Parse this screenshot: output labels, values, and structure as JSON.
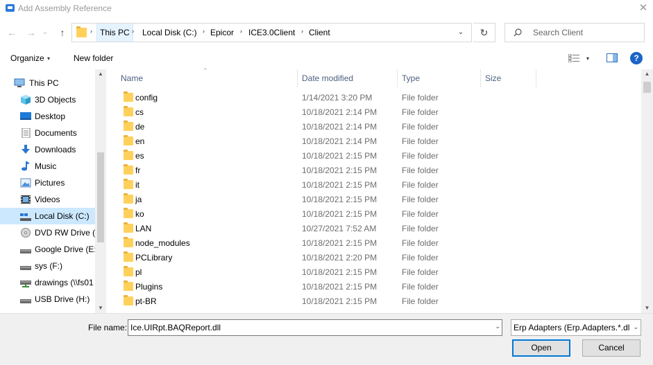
{
  "window": {
    "title": "Add Assembly Reference",
    "close_glyph": "✕"
  },
  "nav": {
    "back": "←",
    "forward": "→",
    "recent": "⌄",
    "up": "↑"
  },
  "address": {
    "crumbs": [
      "This PC",
      "Local Disk (C:)",
      "Epicor",
      "ICE3.0Client",
      "Client"
    ],
    "separator": "›",
    "dropdown_glyph": "⌄",
    "refresh_glyph": "↻"
  },
  "search": {
    "placeholder": "Search Client"
  },
  "toolbar": {
    "organize_label": "Organize",
    "caret": "▾",
    "new_folder_label": "New folder",
    "help_label": "?"
  },
  "sidebar": {
    "items": [
      {
        "label": "This PC",
        "icon": "computer-icon"
      },
      {
        "label": "3D Objects",
        "icon": "cube-icon"
      },
      {
        "label": "Desktop",
        "icon": "desktop-icon"
      },
      {
        "label": "Documents",
        "icon": "document-icon"
      },
      {
        "label": "Downloads",
        "icon": "download-icon"
      },
      {
        "label": "Music",
        "icon": "music-icon"
      },
      {
        "label": "Pictures",
        "icon": "pictures-icon"
      },
      {
        "label": "Videos",
        "icon": "video-icon"
      },
      {
        "label": "Local Disk (C:)",
        "icon": "drive-icon",
        "selected": true
      },
      {
        "label": "DVD RW Drive (D",
        "icon": "dvd-icon"
      },
      {
        "label": "Google Drive (E:)",
        "icon": "drive-icon"
      },
      {
        "label": "sys (F:)",
        "icon": "drive-icon"
      },
      {
        "label": "drawings (\\\\fs01",
        "icon": "network-drive-icon"
      },
      {
        "label": "USB Drive (H:)",
        "icon": "drive-icon"
      }
    ],
    "scroll_up": "▲",
    "scroll_down": "▼"
  },
  "columns": {
    "name": "Name",
    "date": "Date modified",
    "type": "Type",
    "size": "Size",
    "sort_glyph": "^"
  },
  "files": [
    {
      "name": "config",
      "date": "1/14/2021 3:20 PM",
      "type": "File folder"
    },
    {
      "name": "cs",
      "date": "10/18/2021 2:14 PM",
      "type": "File folder"
    },
    {
      "name": "de",
      "date": "10/18/2021 2:14 PM",
      "type": "File folder"
    },
    {
      "name": "en",
      "date": "10/18/2021 2:14 PM",
      "type": "File folder"
    },
    {
      "name": "es",
      "date": "10/18/2021 2:15 PM",
      "type": "File folder"
    },
    {
      "name": "fr",
      "date": "10/18/2021 2:15 PM",
      "type": "File folder"
    },
    {
      "name": "it",
      "date": "10/18/2021 2:15 PM",
      "type": "File folder"
    },
    {
      "name": "ja",
      "date": "10/18/2021 2:15 PM",
      "type": "File folder"
    },
    {
      "name": "ko",
      "date": "10/18/2021 2:15 PM",
      "type": "File folder"
    },
    {
      "name": "LAN",
      "date": "10/27/2021 7:52 AM",
      "type": "File folder"
    },
    {
      "name": "node_modules",
      "date": "10/18/2021 2:15 PM",
      "type": "File folder"
    },
    {
      "name": "PCLibrary",
      "date": "10/18/2021 2:20 PM",
      "type": "File folder"
    },
    {
      "name": "pl",
      "date": "10/18/2021 2:15 PM",
      "type": "File folder"
    },
    {
      "name": "Plugins",
      "date": "10/18/2021 2:15 PM",
      "type": "File folder"
    },
    {
      "name": "pt-BR",
      "date": "10/18/2021 2:15 PM",
      "type": "File folder"
    }
  ],
  "list_scroll": {
    "up": "▲",
    "down": "▼"
  },
  "footer": {
    "file_name_label": "File name:",
    "file_name_value": "Ice.UIRpt.BAQReport.dll",
    "dropdown_glyph": "⌄",
    "filter_value": "Erp Adapters (Erp.Adapters.*.dll",
    "open_label": "Open",
    "cancel_label": "Cancel"
  },
  "colors": {
    "selected_bg": "#cce8ff",
    "folder_yellow": "#ffd15c",
    "accent_blue": "#0078d7",
    "header_text": "#4d6082"
  }
}
